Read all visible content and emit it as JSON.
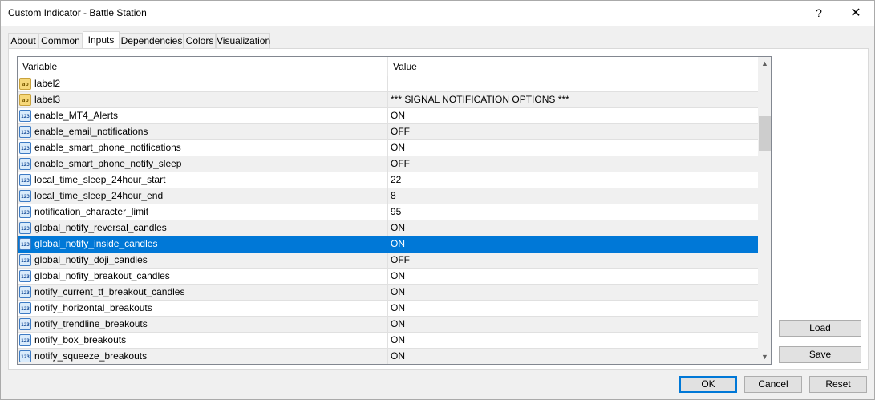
{
  "window": {
    "title": "Custom Indicator - Battle Station",
    "help_glyph": "?",
    "close_glyph": "✕"
  },
  "tabs": [
    {
      "label": "About"
    },
    {
      "label": "Common"
    },
    {
      "label": "Inputs"
    },
    {
      "label": "Dependencies"
    },
    {
      "label": "Colors"
    },
    {
      "label": "Visualization"
    }
  ],
  "active_tab": "Inputs",
  "grid": {
    "headers": {
      "variable": "Variable",
      "value": "Value"
    },
    "rows": [
      {
        "icon": "text-type-icon",
        "name": "label2",
        "value": ""
      },
      {
        "icon": "text-type-icon",
        "name": "label3",
        "value": "*** SIGNAL NOTIFICATION OPTIONS ***"
      },
      {
        "icon": "number-type-icon",
        "name": "enable_MT4_Alerts",
        "value": "ON"
      },
      {
        "icon": "number-type-icon",
        "name": "enable_email_notifications",
        "value": "OFF"
      },
      {
        "icon": "number-type-icon",
        "name": "enable_smart_phone_notifications",
        "value": "ON"
      },
      {
        "icon": "number-type-icon",
        "name": "enable_smart_phone_notify_sleep",
        "value": "OFF"
      },
      {
        "icon": "number-type-icon",
        "name": "local_time_sleep_24hour_start",
        "value": "22"
      },
      {
        "icon": "number-type-icon",
        "name": "local_time_sleep_24hour_end",
        "value": "8"
      },
      {
        "icon": "number-type-icon",
        "name": "notification_character_limit",
        "value": "95"
      },
      {
        "icon": "number-type-icon",
        "name": "global_notify_reversal_candles",
        "value": "ON"
      },
      {
        "icon": "number-type-icon",
        "name": "global_notify_inside_candles",
        "value": "ON"
      },
      {
        "icon": "number-type-icon",
        "name": "global_notify_doji_candles",
        "value": "OFF"
      },
      {
        "icon": "number-type-icon",
        "name": "global_nofity_breakout_candles",
        "value": "ON"
      },
      {
        "icon": "number-type-icon",
        "name": "notify_current_tf_breakout_candles",
        "value": "ON"
      },
      {
        "icon": "number-type-icon",
        "name": "notify_horizontal_breakouts",
        "value": "ON"
      },
      {
        "icon": "number-type-icon",
        "name": "notify_trendline_breakouts",
        "value": "ON"
      },
      {
        "icon": "number-type-icon",
        "name": "notify_box_breakouts",
        "value": "ON"
      },
      {
        "icon": "number-type-icon",
        "name": "notify_squeeze_breakouts",
        "value": "ON"
      }
    ],
    "selected_row": 10,
    "icon_text": {
      "text": "ab",
      "number": "123"
    }
  },
  "buttons": {
    "load": "Load",
    "save": "Save",
    "ok": "OK",
    "cancel": "Cancel",
    "reset": "Reset"
  },
  "colors": {
    "selection": "#0078d7",
    "text_icon": "#f6d87a",
    "number_icon": "#d9ebfb"
  }
}
